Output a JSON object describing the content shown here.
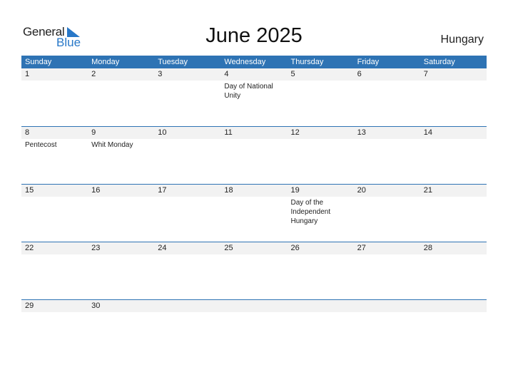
{
  "logo": {
    "word1": "General",
    "word2": "Blue",
    "icon": "triangle-flag-icon"
  },
  "title": "June 2025",
  "country": "Hungary",
  "colors": {
    "accent": "#2e73b4",
    "date_strip": "#f2f2f2",
    "logo_blue": "#2878c8"
  },
  "weekdays": [
    "Sunday",
    "Monday",
    "Tuesday",
    "Wednesday",
    "Thursday",
    "Friday",
    "Saturday"
  ],
  "weeks": [
    [
      {
        "date": "1",
        "event": ""
      },
      {
        "date": "2",
        "event": ""
      },
      {
        "date": "3",
        "event": ""
      },
      {
        "date": "4",
        "event": "Day of National Unity"
      },
      {
        "date": "5",
        "event": ""
      },
      {
        "date": "6",
        "event": ""
      },
      {
        "date": "7",
        "event": ""
      }
    ],
    [
      {
        "date": "8",
        "event": "Pentecost"
      },
      {
        "date": "9",
        "event": "Whit Monday"
      },
      {
        "date": "10",
        "event": ""
      },
      {
        "date": "11",
        "event": ""
      },
      {
        "date": "12",
        "event": ""
      },
      {
        "date": "13",
        "event": ""
      },
      {
        "date": "14",
        "event": ""
      }
    ],
    [
      {
        "date": "15",
        "event": ""
      },
      {
        "date": "16",
        "event": ""
      },
      {
        "date": "17",
        "event": ""
      },
      {
        "date": "18",
        "event": ""
      },
      {
        "date": "19",
        "event": "Day of the Independent Hungary"
      },
      {
        "date": "20",
        "event": ""
      },
      {
        "date": "21",
        "event": ""
      }
    ],
    [
      {
        "date": "22",
        "event": ""
      },
      {
        "date": "23",
        "event": ""
      },
      {
        "date": "24",
        "event": ""
      },
      {
        "date": "25",
        "event": ""
      },
      {
        "date": "26",
        "event": ""
      },
      {
        "date": "27",
        "event": ""
      },
      {
        "date": "28",
        "event": ""
      }
    ],
    [
      {
        "date": "29",
        "event": ""
      },
      {
        "date": "30",
        "event": ""
      },
      {
        "date": "",
        "event": ""
      },
      {
        "date": "",
        "event": ""
      },
      {
        "date": "",
        "event": ""
      },
      {
        "date": "",
        "event": ""
      },
      {
        "date": "",
        "event": ""
      }
    ]
  ]
}
